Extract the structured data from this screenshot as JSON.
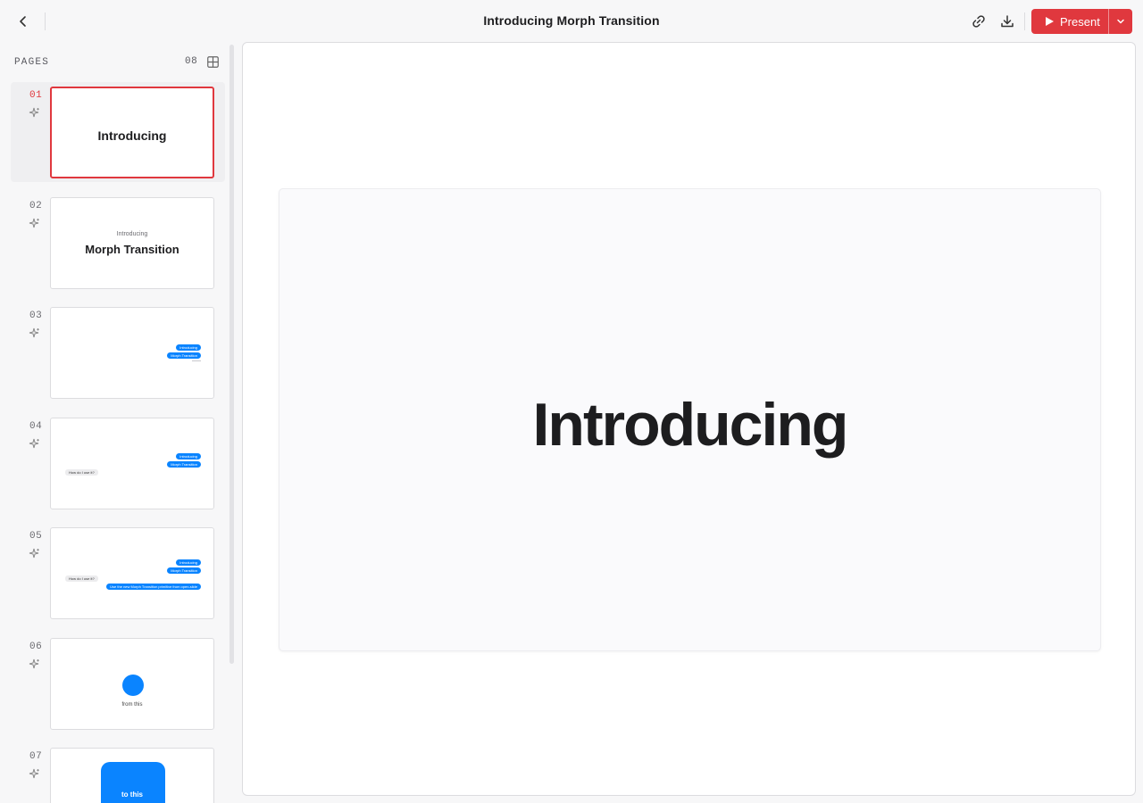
{
  "header": {
    "title": "Introducing Morph Transition",
    "present_label": "Present"
  },
  "icons": {
    "back": "chevron-left-icon",
    "link": "link-icon",
    "download": "download-icon",
    "present": "play-icon",
    "dropdown": "chevron-down-icon",
    "grid": "grid-icon",
    "page_action": "sparkle-icon"
  },
  "colors": {
    "accent": "#e0383e",
    "blue": "#0a84ff"
  },
  "sidebar": {
    "label": "PAGES",
    "count": "08",
    "pages": [
      {
        "num": "01",
        "title": "Introducing"
      },
      {
        "num": "02",
        "subtitle": "Introducing",
        "title": "Morph Transition"
      },
      {
        "num": "03",
        "pills": [
          "Introducing",
          "Morph Transition"
        ]
      },
      {
        "num": "04",
        "pills": [
          "Introducing",
          "Morph Transition"
        ],
        "question": "How do I use it?"
      },
      {
        "num": "05",
        "pills": [
          "Introducing",
          "Morph Transition"
        ],
        "question": "How do I use it?",
        "answer": "Use the new Morph Transition primitive from open-slide"
      },
      {
        "num": "06",
        "caption": "from this"
      },
      {
        "num": "07",
        "caption": "to this"
      }
    ]
  },
  "main": {
    "slide_title": "Introducing"
  }
}
